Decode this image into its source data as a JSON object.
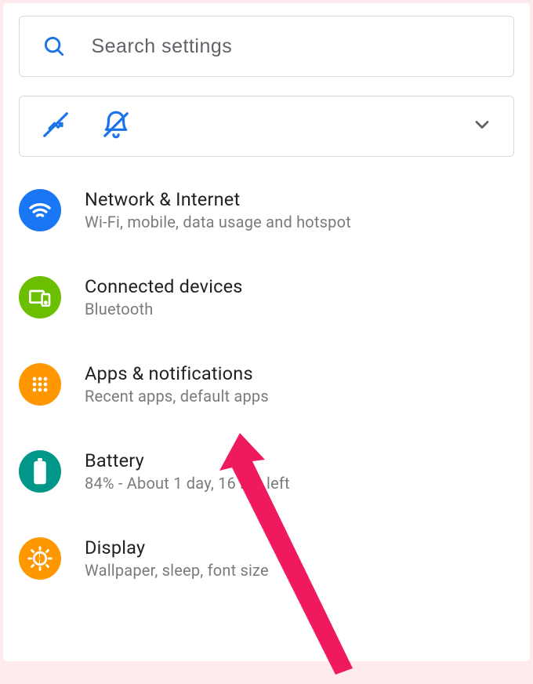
{
  "search": {
    "placeholder": "Search settings"
  },
  "colors": {
    "blue": "#1a73e8",
    "brightBlue": "#1976f5",
    "green": "#6bbf00",
    "orange": "#ff9800",
    "teal": "#009688",
    "arrow": "#ef1a5d"
  },
  "settings": [
    {
      "icon": "wifi-icon",
      "title": "Network & Internet",
      "subtitle": "Wi-Fi, mobile, data usage and hotspot"
    },
    {
      "icon": "devices-icon",
      "title": "Connected devices",
      "subtitle": "Bluetooth"
    },
    {
      "icon": "apps-icon",
      "title": "Apps & notifications",
      "subtitle": "Recent apps, default apps"
    },
    {
      "icon": "battery-icon",
      "title": "Battery",
      "subtitle": "84% - About 1 day, 16 hrs left"
    },
    {
      "icon": "display-icon",
      "title": "Display",
      "subtitle": "Wallpaper, sleep, font size"
    }
  ]
}
